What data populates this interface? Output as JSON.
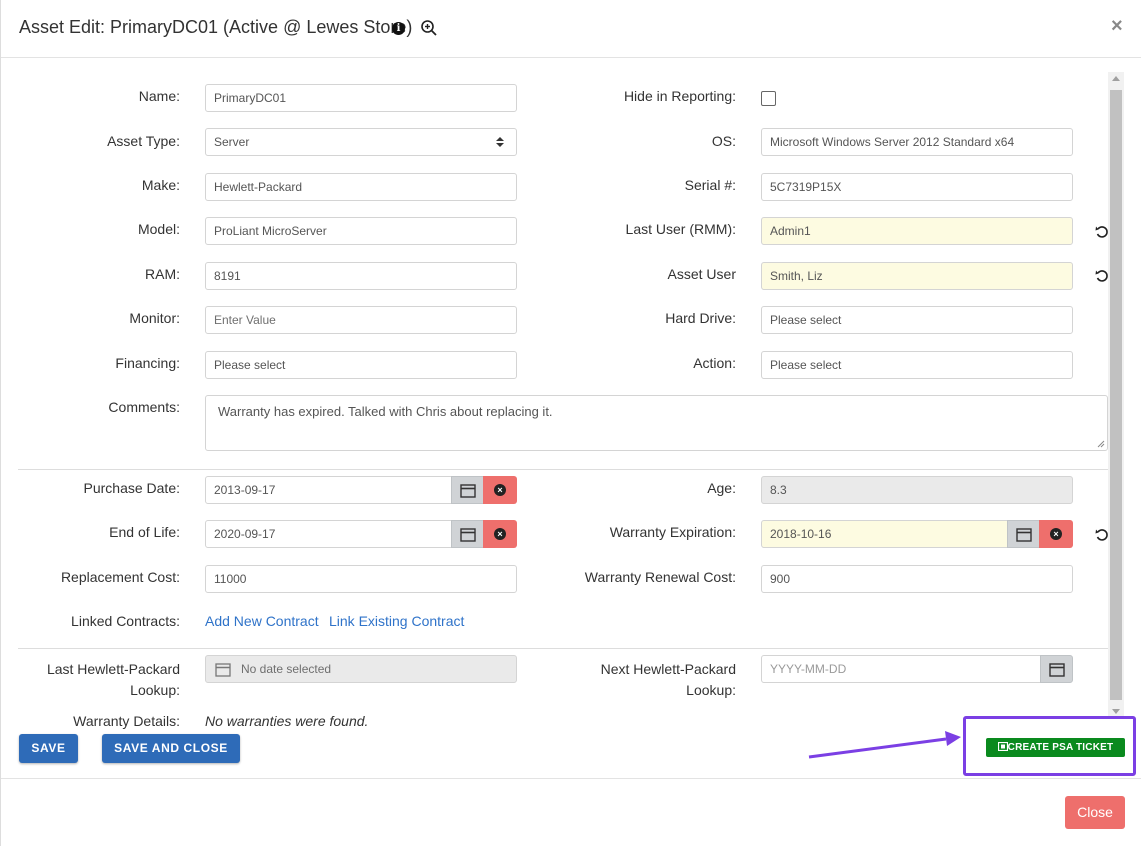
{
  "dialog": {
    "title": "Asset Edit: PrimaryDC01 (Active @ Lewes Store)",
    "close_glyph": "×"
  },
  "icons": {
    "info": "info-icon",
    "zoom": "zoom-in-icon",
    "reset": "refresh-icon",
    "calendar": "calendar-icon",
    "clear": "clear-icon",
    "psa": "ticket-icon"
  },
  "form": {
    "name": {
      "label": "Name:",
      "value": "PrimaryDC01"
    },
    "hide_in_reporting": {
      "label": "Hide in Reporting:",
      "checked": false
    },
    "asset_type": {
      "label": "Asset Type:",
      "value": "Server"
    },
    "os": {
      "label": "OS:",
      "value": "Microsoft Windows Server 2012 Standard x64"
    },
    "make": {
      "label": "Make:",
      "value": "Hewlett-Packard"
    },
    "serial": {
      "label": "Serial #:",
      "value": "5C7319P15X"
    },
    "model": {
      "label": "Model:",
      "value": "ProLiant MicroServer"
    },
    "last_user": {
      "label": "Last User (RMM):",
      "value": "Admin1"
    },
    "ram": {
      "label": "RAM:",
      "value": "8191"
    },
    "asset_user": {
      "label": "Asset User",
      "value": "Smith, Liz"
    },
    "monitor": {
      "label": "Monitor:",
      "placeholder": "Enter Value"
    },
    "hard_drive": {
      "label": "Hard Drive:",
      "placeholder": "Please select"
    },
    "financing": {
      "label": "Financing:",
      "placeholder": "Please select"
    },
    "action": {
      "label": "Action:",
      "placeholder": "Please select"
    },
    "comments": {
      "label": "Comments:",
      "value": "Warranty has expired. Talked with Chris about replacing it."
    },
    "purchase_date": {
      "label": "Purchase Date:",
      "value": "2013-09-17"
    },
    "age": {
      "label": "Age:",
      "value": "8.3"
    },
    "end_of_life": {
      "label": "End of Life:",
      "value": "2020-09-17"
    },
    "warranty_expiration": {
      "label": "Warranty Expiration:",
      "value": "2018-10-16"
    },
    "replacement_cost": {
      "label": "Replacement Cost:",
      "value": "11000"
    },
    "warranty_renewal_cost": {
      "label": "Warranty Renewal Cost:",
      "value": "900"
    },
    "linked_contracts": {
      "label": "Linked Contracts:",
      "add_link": "Add New Contract",
      "existing_link": "Link Existing Contract"
    },
    "last_lookup": {
      "label_line1": "Last Hewlett-Packard",
      "label_line2": "Lookup:",
      "placeholder": "No date selected"
    },
    "next_lookup": {
      "label_line1": "Next Hewlett-Packard",
      "label_line2": "Lookup:",
      "placeholder": "YYYY-MM-DD"
    },
    "warranty_details": {
      "label": "Warranty Details:",
      "value": "No warranties were found."
    }
  },
  "buttons": {
    "save": "SAVE",
    "save_and_close": "SAVE AND CLOSE",
    "create_psa_ticket": "CREATE PSA TICKET",
    "close": "Close"
  },
  "colors": {
    "primary_blue": "#2e6bb8",
    "psa_green": "#0a8a1e",
    "danger_red": "#ee6f6c",
    "highlight_yellow": "#fdfbe1",
    "annotation_purple": "#7b3fe4"
  }
}
